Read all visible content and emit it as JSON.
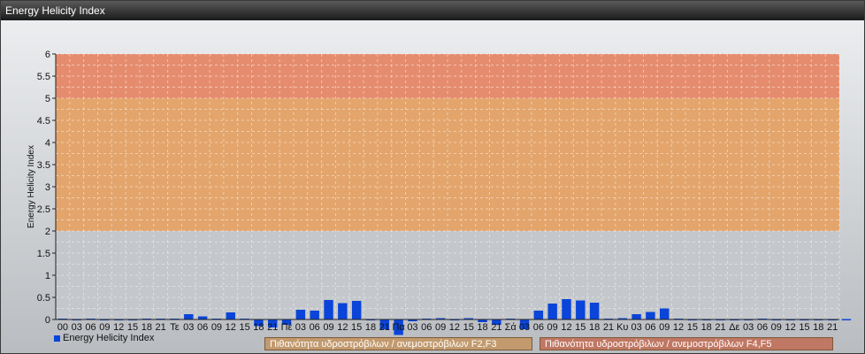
{
  "window_title": "Energy Helicity Index",
  "legend_label": "Energy Helicity Index",
  "bands": [
    {
      "label": "Πιθανότητα υδροστρόβιλων / ανεμοστρόβιλων F2,F3",
      "from": 2,
      "to": 5,
      "color": "#e3a56c"
    },
    {
      "label": "Πιθανότητα υδροστρόβιλων / ανεμοστρόβιλων F4,F5",
      "from": 5,
      "to": 6,
      "color": "#e68c6e"
    }
  ],
  "colors": {
    "bar": "#0a44d8",
    "low_band": "#c4c7cb"
  },
  "chart_data": {
    "type": "bar",
    "title": "",
    "ylabel": "Energy Helicity Index",
    "xlabel": "",
    "ylim": [
      0,
      6
    ],
    "yticks": [
      "0",
      "0.5",
      "1",
      "1.5",
      "2",
      "2.5",
      "3",
      "3.5",
      "4",
      "4.5",
      "5",
      "5.5",
      "6"
    ],
    "grid": true,
    "legend_position": "bottom-left",
    "categories": [
      "00",
      "03",
      "06",
      "09",
      "12",
      "15",
      "18",
      "21",
      "Τε",
      "03",
      "06",
      "09",
      "12",
      "15",
      "18",
      "21",
      "Πέ",
      "03",
      "06",
      "09",
      "12",
      "15",
      "18",
      "21",
      "Πα",
      "03",
      "06",
      "09",
      "12",
      "15",
      "18",
      "21",
      "Σά",
      "03",
      "06",
      "09",
      "12",
      "15",
      "18",
      "21",
      "Κυ",
      "03",
      "06",
      "09",
      "12",
      "15",
      "18",
      "21",
      "Δε",
      "03",
      "06",
      "09",
      "12",
      "15",
      "18",
      "21"
    ],
    "series": [
      {
        "name": "Energy Helicity Index",
        "values": [
          0.02,
          0.01,
          0.02,
          0.01,
          0.01,
          0.01,
          0.02,
          0.02,
          0.02,
          0.12,
          0.07,
          0.02,
          0.16,
          0.02,
          -0.15,
          -0.18,
          -0.12,
          0.22,
          0.2,
          0.44,
          0.37,
          0.42,
          0.01,
          -0.22,
          -0.35,
          -0.04,
          0.02,
          0.03,
          0.01,
          0.03,
          -0.06,
          -0.12,
          0.02,
          -0.22,
          0.2,
          0.36,
          0.46,
          0.43,
          0.38,
          0.02,
          0.03,
          0.12,
          0.17,
          0.25,
          0.02,
          0.01,
          0.01,
          0.01,
          0.01,
          0.01,
          0.02,
          0.01,
          0.01,
          0.01,
          0.01,
          0.01,
          0.01
        ]
      }
    ]
  }
}
